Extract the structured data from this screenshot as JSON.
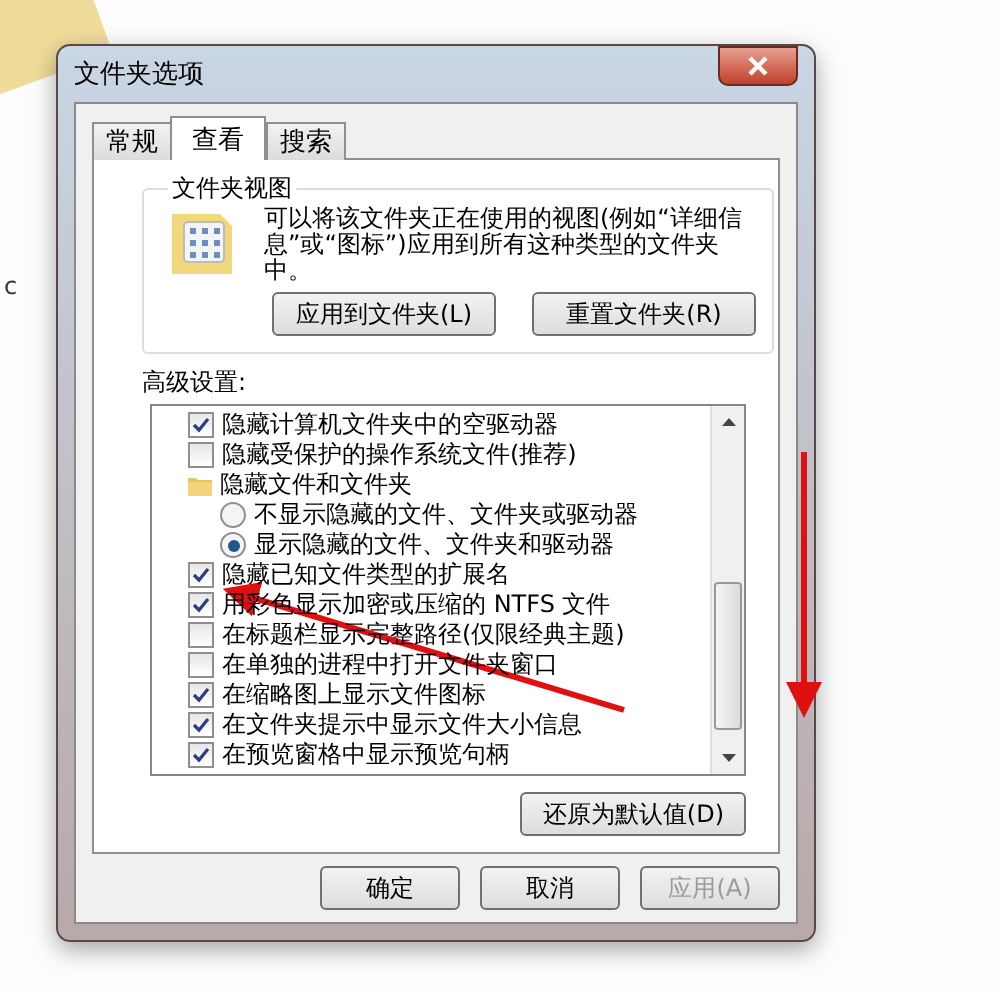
{
  "stray_text": "c",
  "window": {
    "title": "文件夹选项"
  },
  "tabs": [
    {
      "label": "常规",
      "selected": false
    },
    {
      "label": "查看",
      "selected": true
    },
    {
      "label": "搜索",
      "selected": false
    }
  ],
  "folder_views": {
    "title": "文件夹视图",
    "description": "可以将该文件夹正在使用的视图(例如“详细信息”或“图标”)应用到所有这种类型的文件夹中。",
    "buttons": [
      "应用到文件夹(L)",
      "重置文件夹(R)"
    ]
  },
  "advanced": {
    "label": "高级设置:",
    "items": [
      {
        "kind": "checkbox",
        "label": "隐藏计算机文件夹中的空驱动器",
        "checked": true
      },
      {
        "kind": "checkbox",
        "label": "隐藏受保护的操作系统文件(推荐)",
        "checked": false
      },
      {
        "kind": "folder",
        "label": "隐藏文件和文件夹",
        "children": [
          {
            "kind": "radio",
            "label": "不显示隐藏的文件、文件夹或驱动器",
            "selected": false
          },
          {
            "kind": "radio",
            "label": "显示隐藏的文件、文件夹和驱动器",
            "selected": true
          }
        ]
      },
      {
        "kind": "checkbox",
        "label": "隐藏已知文件类型的扩展名",
        "checked": true
      },
      {
        "kind": "checkbox",
        "label": "用彩色显示加密或压缩的 NTFS 文件",
        "checked": true
      },
      {
        "kind": "checkbox",
        "label": "在标题栏显示完整路径(仅限经典主题)",
        "checked": false
      },
      {
        "kind": "checkbox",
        "label": "在单独的进程中打开文件夹窗口",
        "checked": false
      },
      {
        "kind": "checkbox",
        "label": "在缩略图上显示文件图标",
        "checked": true
      },
      {
        "kind": "checkbox",
        "label": "在文件夹提示中显示文件大小信息",
        "checked": true
      },
      {
        "kind": "checkbox",
        "label": "在预览窗格中显示预览句柄",
        "checked": true
      }
    ],
    "restore_button": "还原为默认值(D)"
  },
  "footer_buttons": [
    {
      "label": "确定",
      "disabled": false
    },
    {
      "label": "取消",
      "disabled": false
    },
    {
      "label": "应用(A)",
      "disabled": true
    }
  ]
}
